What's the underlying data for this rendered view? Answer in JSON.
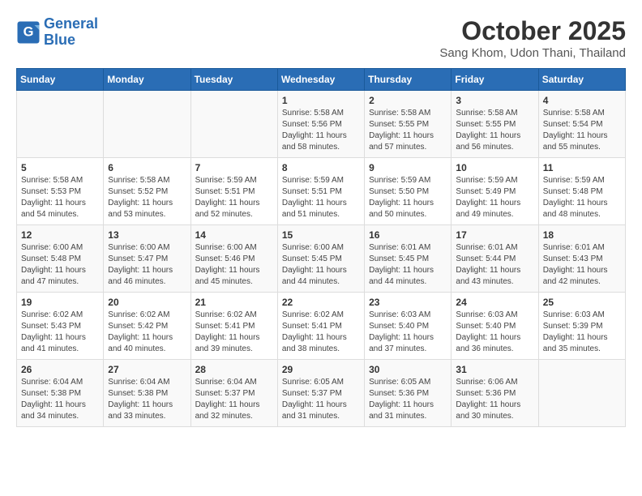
{
  "header": {
    "logo_line1": "General",
    "logo_line2": "Blue",
    "month": "October 2025",
    "location": "Sang Khom, Udon Thani, Thailand"
  },
  "weekdays": [
    "Sunday",
    "Monday",
    "Tuesday",
    "Wednesday",
    "Thursday",
    "Friday",
    "Saturday"
  ],
  "weeks": [
    [
      {
        "day": "",
        "info": ""
      },
      {
        "day": "",
        "info": ""
      },
      {
        "day": "",
        "info": ""
      },
      {
        "day": "1",
        "info": "Sunrise: 5:58 AM\nSunset: 5:56 PM\nDaylight: 11 hours and 58 minutes."
      },
      {
        "day": "2",
        "info": "Sunrise: 5:58 AM\nSunset: 5:55 PM\nDaylight: 11 hours and 57 minutes."
      },
      {
        "day": "3",
        "info": "Sunrise: 5:58 AM\nSunset: 5:55 PM\nDaylight: 11 hours and 56 minutes."
      },
      {
        "day": "4",
        "info": "Sunrise: 5:58 AM\nSunset: 5:54 PM\nDaylight: 11 hours and 55 minutes."
      }
    ],
    [
      {
        "day": "5",
        "info": "Sunrise: 5:58 AM\nSunset: 5:53 PM\nDaylight: 11 hours and 54 minutes."
      },
      {
        "day": "6",
        "info": "Sunrise: 5:58 AM\nSunset: 5:52 PM\nDaylight: 11 hours and 53 minutes."
      },
      {
        "day": "7",
        "info": "Sunrise: 5:59 AM\nSunset: 5:51 PM\nDaylight: 11 hours and 52 minutes."
      },
      {
        "day": "8",
        "info": "Sunrise: 5:59 AM\nSunset: 5:51 PM\nDaylight: 11 hours and 51 minutes."
      },
      {
        "day": "9",
        "info": "Sunrise: 5:59 AM\nSunset: 5:50 PM\nDaylight: 11 hours and 50 minutes."
      },
      {
        "day": "10",
        "info": "Sunrise: 5:59 AM\nSunset: 5:49 PM\nDaylight: 11 hours and 49 minutes."
      },
      {
        "day": "11",
        "info": "Sunrise: 5:59 AM\nSunset: 5:48 PM\nDaylight: 11 hours and 48 minutes."
      }
    ],
    [
      {
        "day": "12",
        "info": "Sunrise: 6:00 AM\nSunset: 5:48 PM\nDaylight: 11 hours and 47 minutes."
      },
      {
        "day": "13",
        "info": "Sunrise: 6:00 AM\nSunset: 5:47 PM\nDaylight: 11 hours and 46 minutes."
      },
      {
        "day": "14",
        "info": "Sunrise: 6:00 AM\nSunset: 5:46 PM\nDaylight: 11 hours and 45 minutes."
      },
      {
        "day": "15",
        "info": "Sunrise: 6:00 AM\nSunset: 5:45 PM\nDaylight: 11 hours and 44 minutes."
      },
      {
        "day": "16",
        "info": "Sunrise: 6:01 AM\nSunset: 5:45 PM\nDaylight: 11 hours and 44 minutes."
      },
      {
        "day": "17",
        "info": "Sunrise: 6:01 AM\nSunset: 5:44 PM\nDaylight: 11 hours and 43 minutes."
      },
      {
        "day": "18",
        "info": "Sunrise: 6:01 AM\nSunset: 5:43 PM\nDaylight: 11 hours and 42 minutes."
      }
    ],
    [
      {
        "day": "19",
        "info": "Sunrise: 6:02 AM\nSunset: 5:43 PM\nDaylight: 11 hours and 41 minutes."
      },
      {
        "day": "20",
        "info": "Sunrise: 6:02 AM\nSunset: 5:42 PM\nDaylight: 11 hours and 40 minutes."
      },
      {
        "day": "21",
        "info": "Sunrise: 6:02 AM\nSunset: 5:41 PM\nDaylight: 11 hours and 39 minutes."
      },
      {
        "day": "22",
        "info": "Sunrise: 6:02 AM\nSunset: 5:41 PM\nDaylight: 11 hours and 38 minutes."
      },
      {
        "day": "23",
        "info": "Sunrise: 6:03 AM\nSunset: 5:40 PM\nDaylight: 11 hours and 37 minutes."
      },
      {
        "day": "24",
        "info": "Sunrise: 6:03 AM\nSunset: 5:40 PM\nDaylight: 11 hours and 36 minutes."
      },
      {
        "day": "25",
        "info": "Sunrise: 6:03 AM\nSunset: 5:39 PM\nDaylight: 11 hours and 35 minutes."
      }
    ],
    [
      {
        "day": "26",
        "info": "Sunrise: 6:04 AM\nSunset: 5:38 PM\nDaylight: 11 hours and 34 minutes."
      },
      {
        "day": "27",
        "info": "Sunrise: 6:04 AM\nSunset: 5:38 PM\nDaylight: 11 hours and 33 minutes."
      },
      {
        "day": "28",
        "info": "Sunrise: 6:04 AM\nSunset: 5:37 PM\nDaylight: 11 hours and 32 minutes."
      },
      {
        "day": "29",
        "info": "Sunrise: 6:05 AM\nSunset: 5:37 PM\nDaylight: 11 hours and 31 minutes."
      },
      {
        "day": "30",
        "info": "Sunrise: 6:05 AM\nSunset: 5:36 PM\nDaylight: 11 hours and 31 minutes."
      },
      {
        "day": "31",
        "info": "Sunrise: 6:06 AM\nSunset: 5:36 PM\nDaylight: 11 hours and 30 minutes."
      },
      {
        "day": "",
        "info": ""
      }
    ]
  ]
}
